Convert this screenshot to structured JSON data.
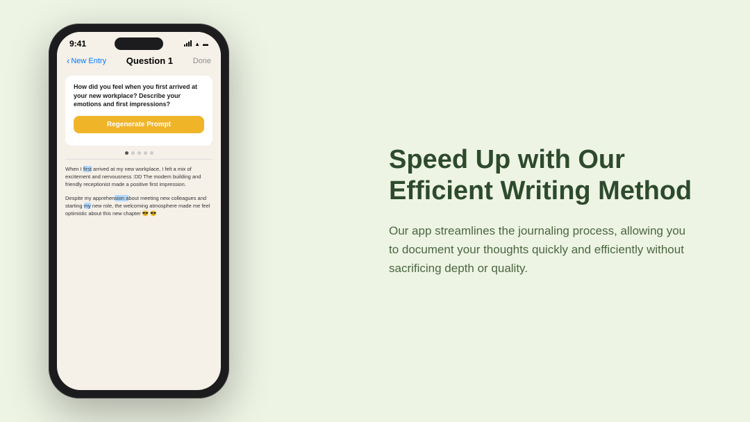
{
  "page": {
    "background_color": "#eef4e4"
  },
  "phone": {
    "status_bar": {
      "time": "9:41"
    },
    "nav": {
      "back_label": "New Entry",
      "title": "Question 1",
      "done_label": "Done"
    },
    "question_card": {
      "question_text": "How did you feel when you first arrived at your new workplace? Describe your emotions and first impressions?",
      "regenerate_button_label": "Regenerate Prompt"
    },
    "dots": [
      {
        "active": true
      },
      {
        "active": false
      },
      {
        "active": false
      },
      {
        "active": false
      },
      {
        "active": false
      }
    ],
    "journal_entry": {
      "paragraph1": "When I first arrived at my new workplace, I felt a mix of excitement and nervousness :DD The modern building and friendly receptionist made a positive first impression.",
      "paragraph2": "Despite my apprehension about meeting new colleagues and starting my new role, the welcoming atmosphere made me feel optimistic about this new chapter 😎😎"
    }
  },
  "right_content": {
    "heading_line1": "Speed Up with Our",
    "heading_line2": "Efficient Writing Method",
    "description": "Our app streamlines the journaling process, allowing you to document your thoughts quickly and efficiently without sacrificing depth or quality."
  }
}
